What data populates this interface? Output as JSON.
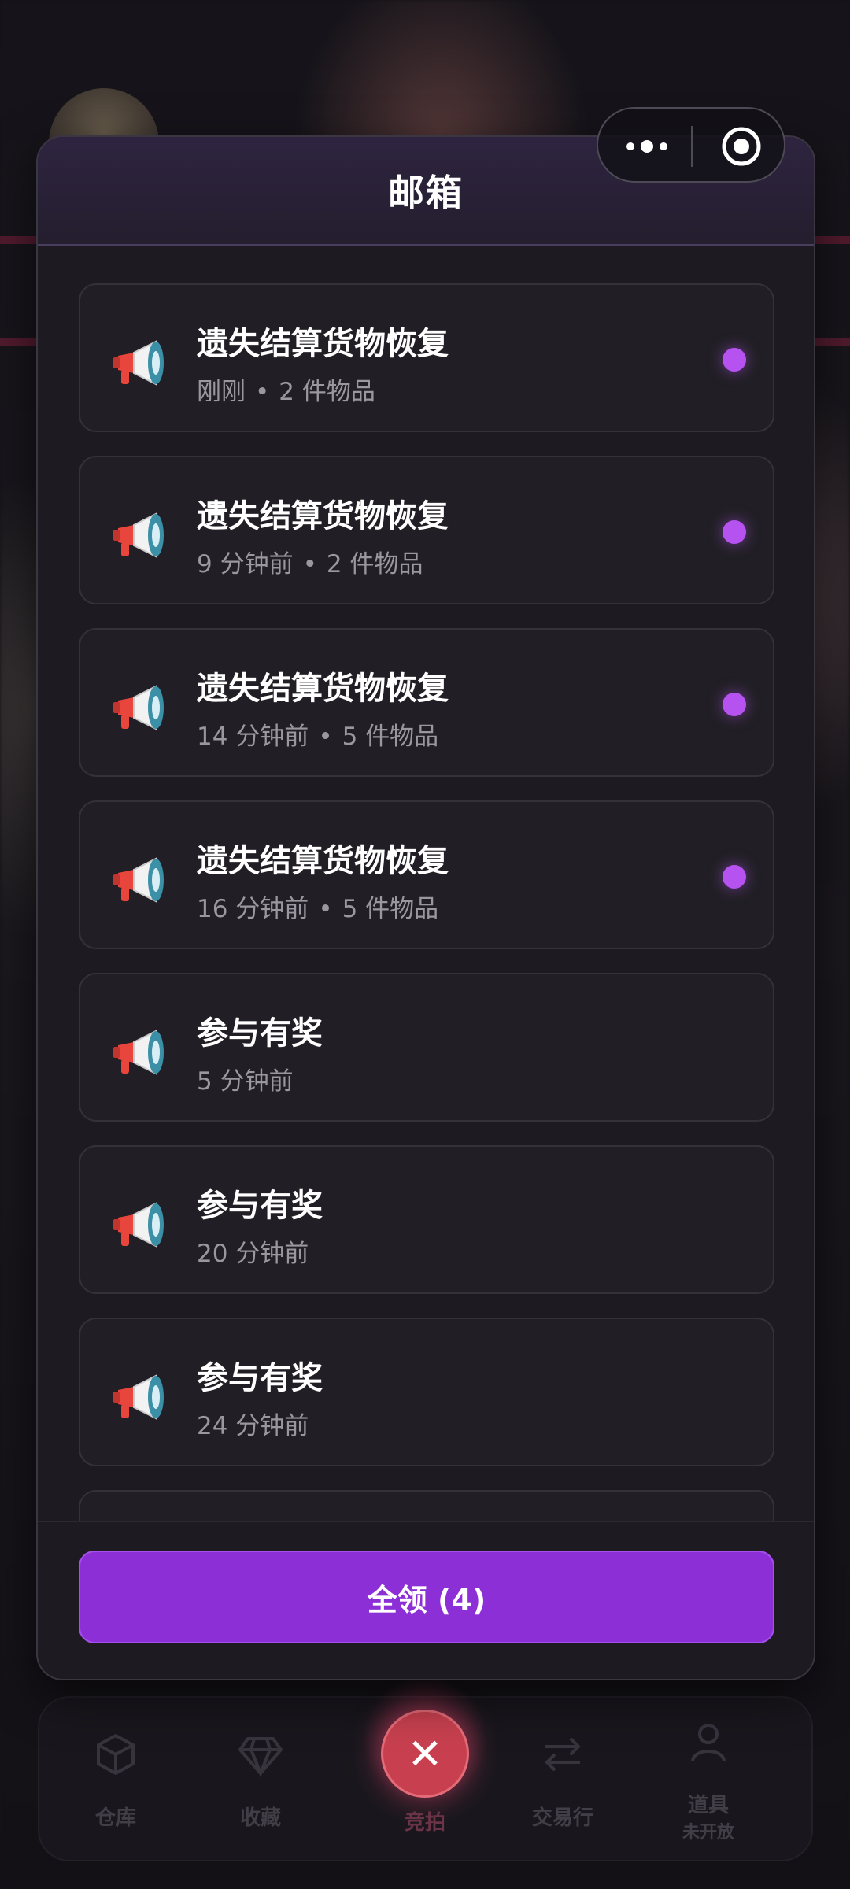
{
  "modal": {
    "title": "邮箱"
  },
  "mail_items": [
    {
      "title": "遗失结算货物恢复",
      "time": "刚刚",
      "items": "2 件物品",
      "unread": true
    },
    {
      "title": "遗失结算货物恢复",
      "time": "9 分钟前",
      "items": "2 件物品",
      "unread": true
    },
    {
      "title": "遗失结算货物恢复",
      "time": "14 分钟前",
      "items": "5 件物品",
      "unread": true
    },
    {
      "title": "遗失结算货物恢复",
      "time": "16 分钟前",
      "items": "5 件物品",
      "unread": true
    },
    {
      "title": "参与有奖",
      "time": "5 分钟前",
      "items": "",
      "unread": false
    },
    {
      "title": "参与有奖",
      "time": "20 分钟前",
      "items": "",
      "unread": false
    },
    {
      "title": "参与有奖",
      "time": "24 分钟前",
      "items": "",
      "unread": false
    }
  ],
  "meta_separator": "•",
  "footer": {
    "claim_all_label": "全领 (4)"
  },
  "bottom_nav": {
    "items": [
      {
        "label": "仓库",
        "icon": "box-icon"
      },
      {
        "label": "收藏",
        "icon": "diamond-icon"
      },
      {
        "label": "竞拍",
        "icon": "close-icon"
      },
      {
        "label": "交易行",
        "icon": "swap-icon"
      },
      {
        "label": "道具",
        "sublabel": "未开放",
        "icon": "user-icon"
      }
    ]
  },
  "colors": {
    "accent": "#8c2fd6",
    "unread_dot": "#b653f0",
    "close_button": "#c8404f"
  },
  "icons": {
    "mail_item": "megaphone-icon",
    "capsule_more": "more-dots-icon",
    "capsule_close": "target-icon"
  }
}
